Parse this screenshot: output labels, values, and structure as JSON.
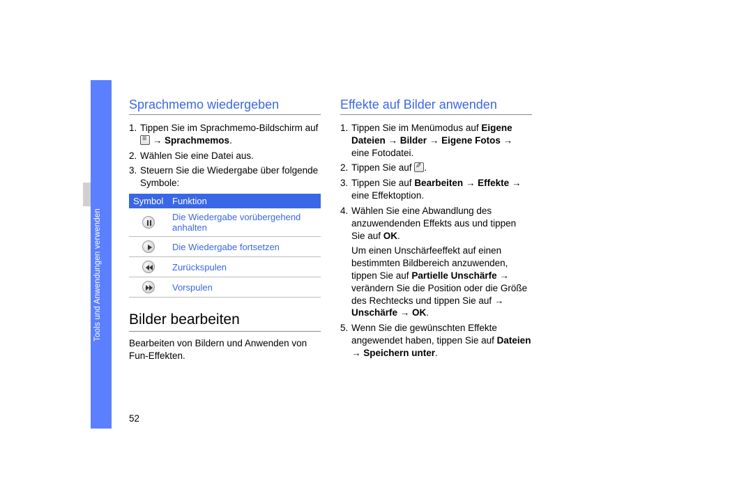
{
  "sidebar": {
    "label": "Tools und Anwendungen verwenden"
  },
  "page_number": "52",
  "left": {
    "heading1": "Sprachmemo wiedergeben",
    "steps": [
      {
        "n": "1.",
        "pre": "Tippen Sie im Sprachmemo-Bildschirm auf ",
        "icon": "menu",
        "arrow": " → ",
        "bold": "Sprachmemos",
        "post": "."
      },
      {
        "n": "2.",
        "pre": "Wählen Sie eine Datei aus.",
        "bold": "",
        "post": ""
      },
      {
        "n": "3.",
        "pre": "Steuern Sie die Wiedergabe über folgende Symbole:",
        "bold": "",
        "post": ""
      }
    ],
    "table": {
      "col1": "Symbol",
      "col2": "Funktion",
      "rows": [
        {
          "icon": "pause",
          "text": "Die Wiedergabe vorübergehend anhalten"
        },
        {
          "icon": "play",
          "text": "Die Wiedergabe fortsetzen"
        },
        {
          "icon": "rew",
          "text": "Zurückspulen"
        },
        {
          "icon": "fwd",
          "text": "Vorspulen"
        }
      ]
    },
    "heading2": "Bilder bearbeiten",
    "intro": "Bearbeiten von Bildern und Anwenden von Fun-Effekten."
  },
  "right": {
    "heading1": "Effekte auf Bilder anwenden",
    "items": [
      {
        "n": "1.",
        "runs": [
          {
            "t": "Tippen Sie im Menümodus auf "
          },
          {
            "t": "Eigene Dateien",
            "b": true
          },
          {
            "t": " → "
          },
          {
            "t": "Bilder",
            "b": true
          },
          {
            "t": " → "
          },
          {
            "t": "Eigene Fotos",
            "b": true
          },
          {
            "t": " → eine Fotodatei."
          }
        ]
      },
      {
        "n": "2.",
        "runs": [
          {
            "t": "Tippen Sie auf "
          },
          {
            "icon": "edit"
          },
          {
            "t": "."
          }
        ]
      },
      {
        "n": "3.",
        "runs": [
          {
            "t": "Tippen Sie auf "
          },
          {
            "t": "Bearbeiten",
            "b": true
          },
          {
            "t": " → "
          },
          {
            "t": "Effekte",
            "b": true
          },
          {
            "t": " → eine Effektoption."
          }
        ]
      },
      {
        "n": "4.",
        "runs": [
          {
            "t": "Wählen Sie eine Abwandlung des anzuwendenden Effekts aus und tippen Sie auf "
          },
          {
            "t": "OK",
            "b": true
          },
          {
            "t": "."
          }
        ],
        "extra": {
          "runs": [
            {
              "t": "Um einen Unschärfeeffekt auf einen bestimmten Bildbereich anzuwenden, tippen Sie auf "
            },
            {
              "t": "Partielle Unschärfe",
              "b": true
            },
            {
              "t": " → verändern Sie die Position oder die Größe des Rechtecks und tippen Sie auf → "
            },
            {
              "t": "Unschärfe",
              "b": true
            },
            {
              "t": " → "
            },
            {
              "t": "OK",
              "b": true
            },
            {
              "t": "."
            }
          ]
        }
      },
      {
        "n": "5.",
        "runs": [
          {
            "t": "Wenn Sie die gewünschten Effekte angewendet haben, tippen Sie auf "
          },
          {
            "t": "Dateien",
            "b": true
          },
          {
            "t": " → "
          },
          {
            "t": "Speichern unter",
            "b": true
          },
          {
            "t": "."
          }
        ]
      }
    ]
  }
}
